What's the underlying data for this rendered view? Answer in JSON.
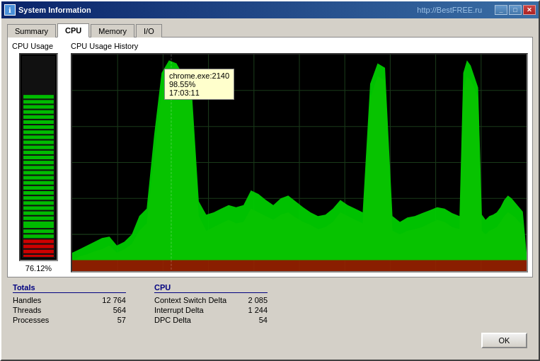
{
  "window": {
    "title": "System Information",
    "url": "http://BestFREE.ru",
    "icon": "ℹ"
  },
  "tabs": {
    "items": [
      "Summary",
      "CPU",
      "Memory",
      "I/O"
    ],
    "active": "CPU"
  },
  "cpu_usage": {
    "label": "CPU Usage",
    "percent": "76.12%",
    "fill_level": 76
  },
  "cpu_history": {
    "label": "CPU Usage History"
  },
  "tooltip": {
    "line1": "chrome.exe:2140",
    "line2": "98.55%",
    "line3": "17:03:11"
  },
  "totals": {
    "title": "Totals",
    "rows": [
      {
        "label": "Handles",
        "value": "12 764"
      },
      {
        "label": "Threads",
        "value": "564"
      },
      {
        "label": "Processes",
        "value": "57"
      }
    ]
  },
  "cpu_stats": {
    "title": "CPU",
    "rows": [
      {
        "label": "Context Switch Delta",
        "value": "2 085"
      },
      {
        "label": "Interrupt Delta",
        "value": "1 244"
      },
      {
        "label": "DPC Delta",
        "value": "54"
      }
    ]
  },
  "buttons": {
    "ok": "OK",
    "minimize": "_",
    "maximize": "□",
    "close": "✕"
  }
}
